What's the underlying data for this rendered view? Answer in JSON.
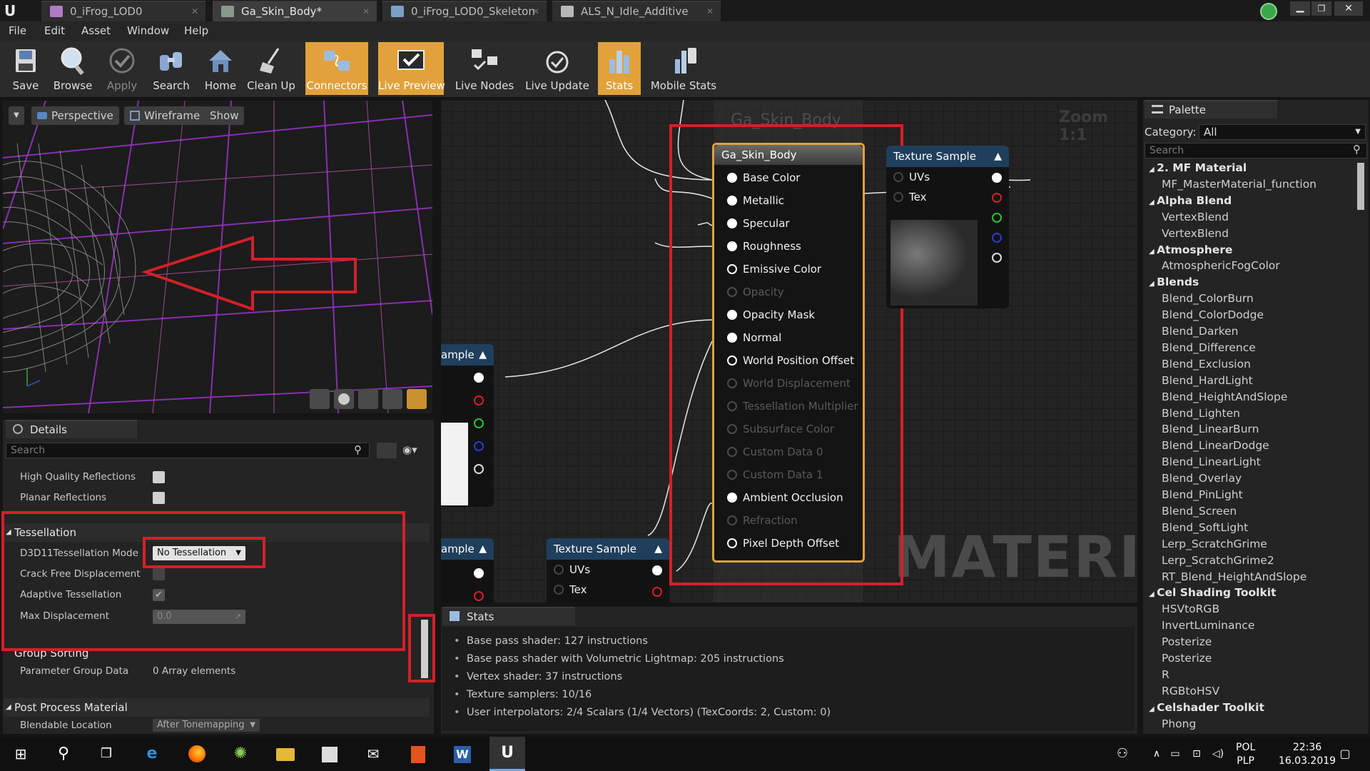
{
  "tabs": [
    {
      "label": "0_iFrog_LOD0",
      "color": "#b07cc6"
    },
    {
      "label": "Ga_Skin_Body*",
      "color": "#8a9a8a"
    },
    {
      "label": "0_iFrog_LOD0_Skeleton",
      "color": "#7aa0c8"
    },
    {
      "label": "ALS_N_Idle_Additive",
      "color": "#b8b8b8"
    }
  ],
  "menu": [
    "File",
    "Edit",
    "Asset",
    "Window",
    "Help"
  ],
  "toolbar": {
    "save": "Save",
    "browse": "Browse",
    "apply": "Apply",
    "search": "Search",
    "home": "Home",
    "cleanup": "Clean Up",
    "connectors": "Connectors",
    "live_preview": "Live Preview",
    "live_nodes": "Live Nodes",
    "live_update": "Live Update",
    "stats": "Stats",
    "mobile_stats": "Mobile Stats"
  },
  "viewport": {
    "perspective": "Perspective",
    "wireframe": "Wireframe",
    "show": "Show"
  },
  "details": {
    "title": "Details",
    "search_placeholder": "Search",
    "rows": {
      "hq_reflections": "High Quality Reflections",
      "planar_reflections": "Planar Reflections",
      "tessellation": "Tessellation",
      "tess_mode_label": "D3D11Tessellation Mode",
      "tess_mode_value": "No Tessellation",
      "crack_free": "Crack Free Displacement",
      "adaptive": "Adaptive Tessellation",
      "max_disp": "Max Displacement",
      "max_disp_value": "0.0",
      "group_sorting": "Group Sorting",
      "param_group": "Parameter Group Data",
      "param_group_value": "0 Array elements",
      "post_process": "Post Process Material",
      "blendable": "Blendable Location",
      "blendable_value": "After Tonemapping"
    }
  },
  "graph": {
    "zoom": "Zoom 1:1",
    "watermark": "MATERIAL",
    "comment_title": "Ga_Skin_Body",
    "main_node": {
      "title": "Ga_Skin_Body",
      "pins": [
        {
          "label": "Base Color",
          "state": "connected"
        },
        {
          "label": "Metallic",
          "state": "connected"
        },
        {
          "label": "Specular",
          "state": "connected"
        },
        {
          "label": "Roughness",
          "state": "connected"
        },
        {
          "label": "Emissive Color",
          "state": "open"
        },
        {
          "label": "Opacity",
          "state": "disabled"
        },
        {
          "label": "Opacity Mask",
          "state": "connected"
        },
        {
          "label": "Normal",
          "state": "connected"
        },
        {
          "label": "World Position Offset",
          "state": "open"
        },
        {
          "label": "World Displacement",
          "state": "disabled"
        },
        {
          "label": "Tessellation Multiplier",
          "state": "disabled"
        },
        {
          "label": "Subsurface Color",
          "state": "disabled"
        },
        {
          "label": "Custom Data 0",
          "state": "disabled"
        },
        {
          "label": "Custom Data 1",
          "state": "disabled"
        },
        {
          "label": "Ambient Occlusion",
          "state": "connected"
        },
        {
          "label": "Refraction",
          "state": "disabled"
        },
        {
          "label": "Pixel Depth Offset",
          "state": "open"
        }
      ]
    },
    "tex_sample_title": "Texture Sample",
    "tex_sample_partial": "ample",
    "uvs": "UVs",
    "tex": "Tex"
  },
  "stats": {
    "title": "Stats",
    "lines": [
      "Base pass shader: 127 instructions",
      "Base pass shader with Volumetric Lightmap: 205 instructions",
      "Vertex shader: 37 instructions",
      "Texture samplers: 10/16",
      "User interpolators: 2/4 Scalars (1/4 Vectors) (TexCoords: 2, Custom: 0)"
    ]
  },
  "palette": {
    "title": "Palette",
    "category_label": "Category:",
    "category_value": "All",
    "search_placeholder": "Search",
    "entries": [
      {
        "t": "c",
        "label": "2. MF Material"
      },
      {
        "t": "i",
        "label": "MF_MasterMaterial_function"
      },
      {
        "t": "c",
        "label": "Alpha Blend"
      },
      {
        "t": "i",
        "label": "VertexBlend"
      },
      {
        "t": "i",
        "label": "VertexBlend"
      },
      {
        "t": "c",
        "label": "Atmosphere"
      },
      {
        "t": "i",
        "label": "AtmosphericFogColor"
      },
      {
        "t": "c",
        "label": "Blends"
      },
      {
        "t": "i",
        "label": "Blend_ColorBurn"
      },
      {
        "t": "i",
        "label": "Blend_ColorDodge"
      },
      {
        "t": "i",
        "label": "Blend_Darken"
      },
      {
        "t": "i",
        "label": "Blend_Difference"
      },
      {
        "t": "i",
        "label": "Blend_Exclusion"
      },
      {
        "t": "i",
        "label": "Blend_HardLight"
      },
      {
        "t": "i",
        "label": "Blend_HeightAndSlope"
      },
      {
        "t": "i",
        "label": "Blend_Lighten"
      },
      {
        "t": "i",
        "label": "Blend_LinearBurn"
      },
      {
        "t": "i",
        "label": "Blend_LinearDodge"
      },
      {
        "t": "i",
        "label": "Blend_LinearLight"
      },
      {
        "t": "i",
        "label": "Blend_Overlay"
      },
      {
        "t": "i",
        "label": "Blend_PinLight"
      },
      {
        "t": "i",
        "label": "Blend_Screen"
      },
      {
        "t": "i",
        "label": "Blend_SoftLight"
      },
      {
        "t": "i",
        "label": "Lerp_ScratchGrime"
      },
      {
        "t": "i",
        "label": "Lerp_ScratchGrime2"
      },
      {
        "t": "i",
        "label": "RT_Blend_HeightAndSlope"
      },
      {
        "t": "c",
        "label": "Cel Shading Toolkit"
      },
      {
        "t": "i",
        "label": "HSVtoRGB"
      },
      {
        "t": "i",
        "label": "InvertLuminance"
      },
      {
        "t": "i",
        "label": "Posterize"
      },
      {
        "t": "i",
        "label": "Posterize"
      },
      {
        "t": "i",
        "label": "R"
      },
      {
        "t": "i",
        "label": "RGBtoHSV"
      },
      {
        "t": "c",
        "label": "Celshader Toolkit"
      },
      {
        "t": "i",
        "label": "Phong"
      }
    ]
  },
  "taskbar": {
    "lang": "POL",
    "layout": "PLP",
    "time": "22:36",
    "date": "16.03.2019"
  },
  "colors": {
    "accent": "#e2a13a",
    "highlight": "#d52027",
    "node_header": "#1f3f5c",
    "main_node_border": "#e2a13a"
  }
}
